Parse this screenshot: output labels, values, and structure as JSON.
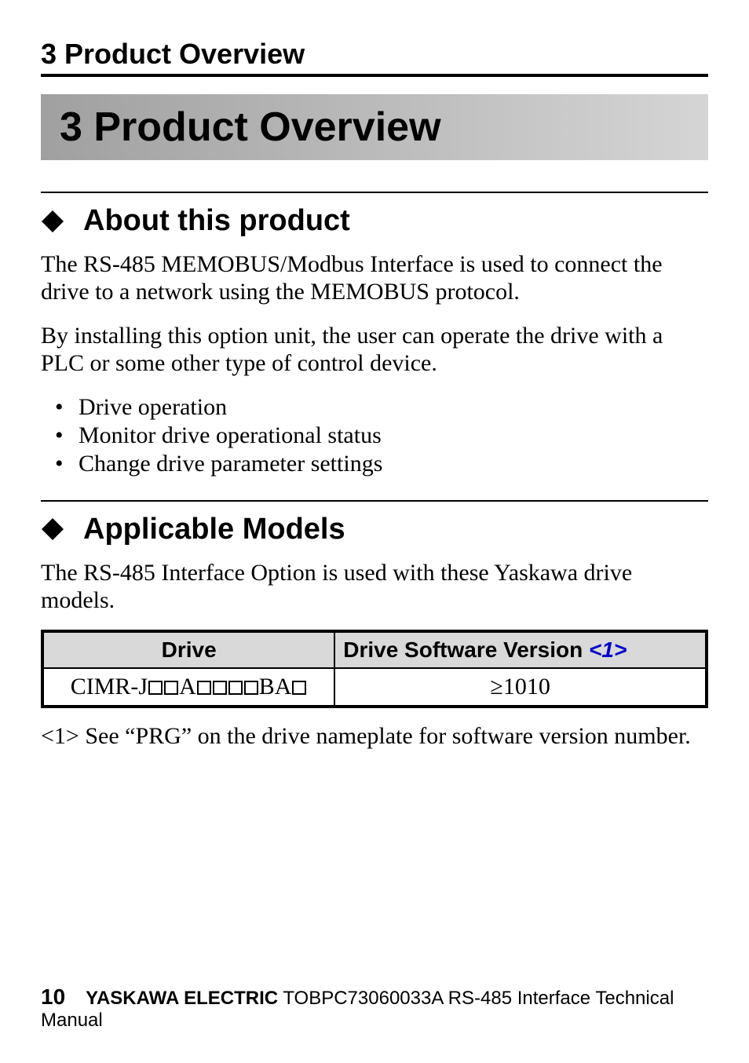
{
  "running_header": "3  Product Overview",
  "chapter_title": "3  Product Overview",
  "sections": [
    {
      "heading": "About this product",
      "paragraphs": [
        "The RS-485 MEMOBUS/Modbus Interface is used to connect the drive to a network using the MEMOBUS protocol.",
        "By installing this option unit, the user can operate the drive with a PLC or some other type of control device."
      ],
      "bullets": [
        "Drive operation",
        "Monitor drive operational status",
        "Change drive parameter settings"
      ]
    },
    {
      "heading": "Applicable Models",
      "paragraphs": [
        "The RS-485 Interface Option is used with these Yaskawa drive models."
      ]
    }
  ],
  "table": {
    "headers": {
      "col1": "Drive",
      "col2_prefix": "Drive Software Version ",
      "col2_ref": "<1>"
    },
    "row": {
      "drive_prefix": "CIMR-J",
      "drive_mid": "A",
      "drive_suffix": "BA",
      "version": "≥1010"
    }
  },
  "footnote": {
    "tag": "<1>",
    "text": "See “PRG” on the drive nameplate for software version number."
  },
  "footer": {
    "page": "10",
    "brand": "YASKAWA ELECTRIC",
    "doc": " TOBPC73060033A RS-485 Interface Technical Manual"
  }
}
